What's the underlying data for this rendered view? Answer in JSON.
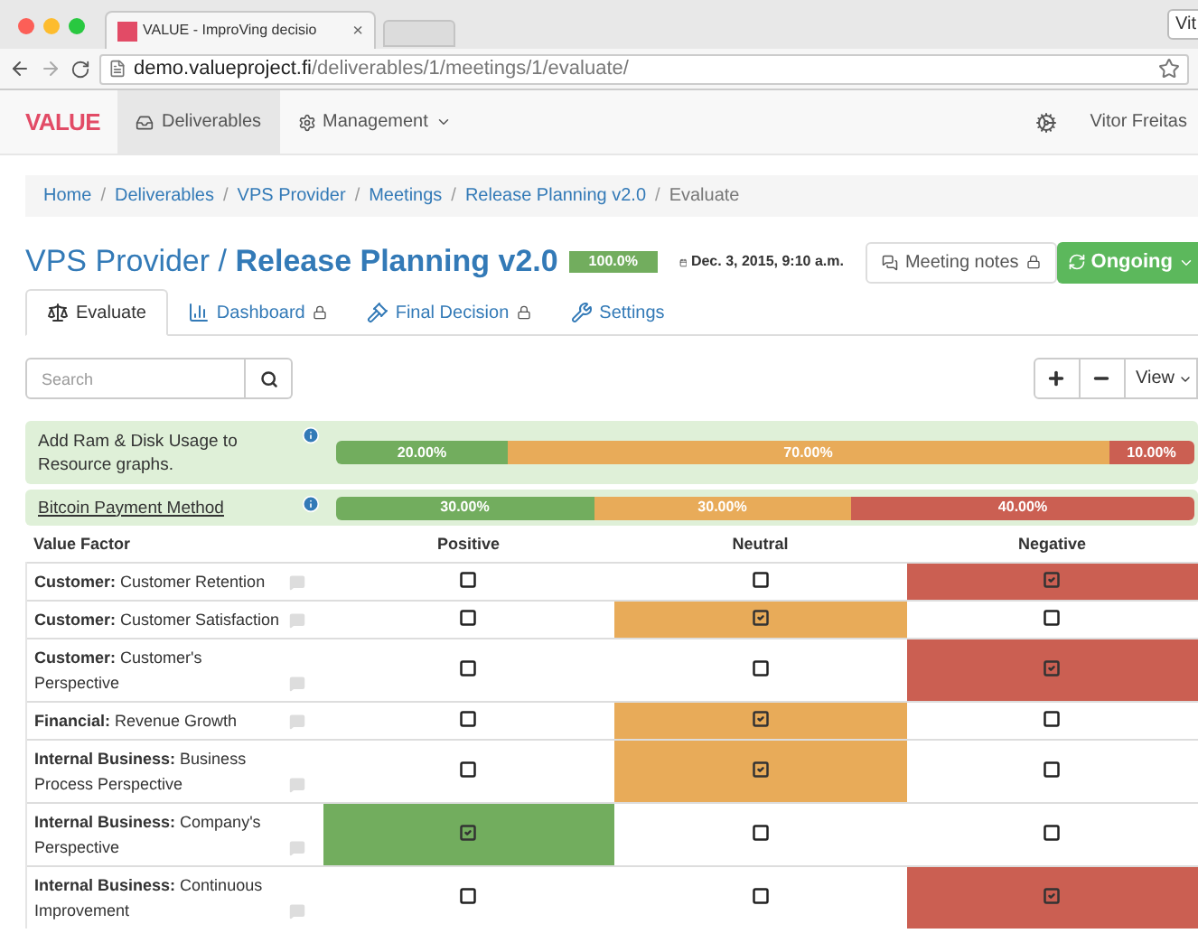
{
  "browser": {
    "tab_title": "VALUE - ImproVing decisio",
    "tab_close": "×",
    "profile_button": "Vit",
    "url_host": "demo.valueproject.fi",
    "url_path": "/deliverables/1/meetings/1/evaluate/"
  },
  "navbar": {
    "brand": "VALUE",
    "items": [
      {
        "label": "Deliverables",
        "selected": true,
        "kind": "link"
      },
      {
        "label": "Management",
        "selected": false,
        "kind": "dropdown"
      }
    ],
    "user": "Vitor Freitas"
  },
  "breadcrumb_separator": "/",
  "breadcrumb": [
    "Home",
    "Deliverables",
    "VPS Provider",
    "Meetings",
    "Release Planning v2.0",
    "Evaluate"
  ],
  "title": {
    "parent": "VPS Provider",
    "separator": "/",
    "name": "Release Planning v2.0"
  },
  "progress": {
    "level": 1.0,
    "label": "100.0%"
  },
  "date": "Dec. 3, 2015, 9:10 a.m.",
  "notes_button": {
    "label": "Meeting notes",
    "locked": true
  },
  "status_button": "Ongoing",
  "tabs": [
    {
      "label": "Evaluate",
      "selected": true,
      "locked": false,
      "kind": "evaluate"
    },
    {
      "label": "Dashboard",
      "selected": false,
      "locked": true,
      "kind": "dashboard"
    },
    {
      "label": "Final Decision",
      "selected": false,
      "locked": true,
      "kind": "decision"
    },
    {
      "label": "Settings",
      "selected": false,
      "locked": false,
      "kind": "settings"
    }
  ],
  "search": {
    "placeholder": "Search"
  },
  "view_button": "View",
  "deliverables": [
    {
      "name": "Add Ram & Disk Usage to Resource graphs.",
      "link": false,
      "segments": [
        {
          "label": "20.00%",
          "color": "#72ad5e"
        },
        {
          "label": "70.00%",
          "color": "#e8ab59"
        },
        {
          "label": "10.00%",
          "color": "#cb5f52"
        }
      ]
    },
    {
      "name": "Bitcoin Payment Method",
      "link": true,
      "segments": [
        {
          "label": "30.00%",
          "color": "#72ad5e"
        },
        {
          "label": "30.00%",
          "color": "#e8ab59"
        },
        {
          "label": "40.00%",
          "color": "#cb5f52"
        }
      ]
    }
  ],
  "table": {
    "factor_heading": "Value Factor",
    "columns": [
      {
        "label": "Positive",
        "color": "#72ad5e"
      },
      {
        "label": "Neutral",
        "color": "#e8ab59"
      },
      {
        "label": "Negative",
        "color": "#cb5f52"
      }
    ],
    "rows": [
      {
        "category": "Customer:",
        "name": "Customer Retention",
        "cells": [
          {
            "checked": false
          },
          {
            "checked": false
          },
          {
            "checked": true
          }
        ]
      },
      {
        "category": "Customer:",
        "name": "Customer Satisfaction",
        "cells": [
          {
            "checked": false
          },
          {
            "checked": true
          },
          {
            "checked": false
          }
        ]
      },
      {
        "category": "Customer:",
        "name": "Customer's Perspective",
        "cells": [
          {
            "checked": false
          },
          {
            "checked": false
          },
          {
            "checked": true
          }
        ]
      },
      {
        "category": "Financial:",
        "name": "Revenue Growth",
        "cells": [
          {
            "checked": false
          },
          {
            "checked": true
          },
          {
            "checked": false
          }
        ]
      },
      {
        "category": "Internal Business:",
        "name": "Business Process Perspective",
        "cells": [
          {
            "checked": false
          },
          {
            "checked": true
          },
          {
            "checked": false
          }
        ]
      },
      {
        "category": "Internal Business:",
        "name": "Company's Perspective",
        "cells": [
          {
            "checked": true
          },
          {
            "checked": false
          },
          {
            "checked": false
          }
        ]
      },
      {
        "category": "Internal Business:",
        "name": "Continuous Improvement",
        "cells": [
          {
            "checked": false
          },
          {
            "checked": false
          },
          {
            "checked": true
          }
        ]
      }
    ]
  }
}
